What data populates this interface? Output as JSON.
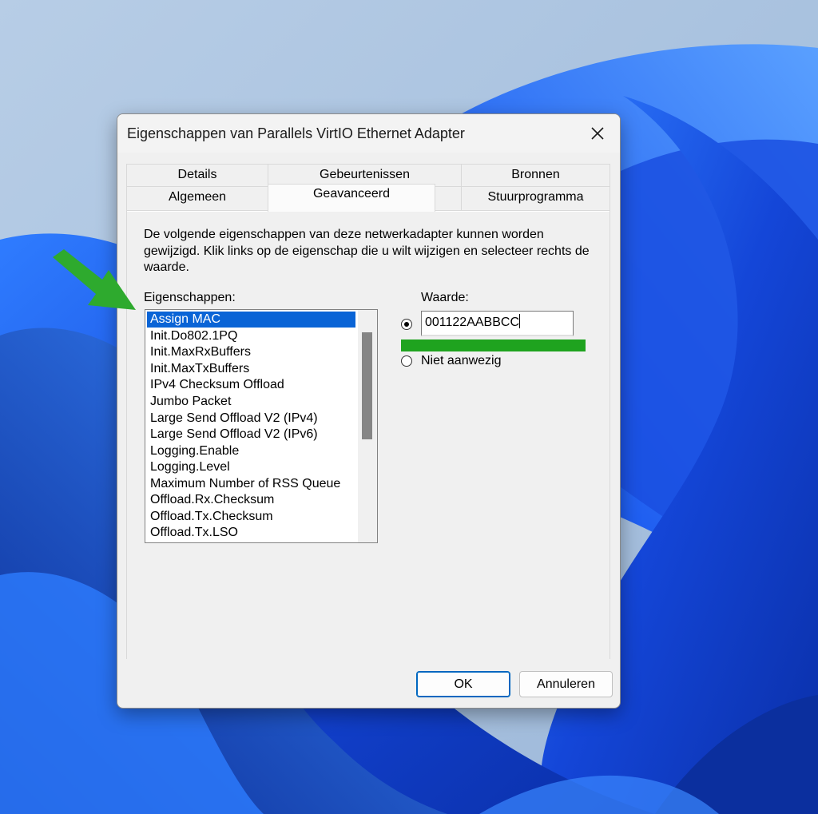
{
  "dialog": {
    "title": "Eigenschappen van Parallels VirtIO Ethernet Adapter"
  },
  "tabs": {
    "row_back": [
      "Details",
      "Gebeurtenissen",
      "Bronnen"
    ],
    "row_front": [
      "Algemeen",
      "Geavanceerd",
      "Stuurprogramma"
    ],
    "active": "Geavanceerd"
  },
  "advanced": {
    "description": "De volgende eigenschappen van deze netwerkadapter kunnen worden gewijzigd. Klik links op de eigenschap die u wilt wijzigen en selecteer rechts de waarde.",
    "properties_label": "Eigenschappen:",
    "properties": [
      "Assign MAC",
      "Init.Do802.1PQ",
      "Init.MaxRxBuffers",
      "Init.MaxTxBuffers",
      "IPv4 Checksum Offload",
      "Jumbo Packet",
      "Large Send Offload V2 (IPv4)",
      "Large Send Offload V2 (IPv6)",
      "Logging.Enable",
      "Logging.Level",
      "Maximum Number of RSS Queue",
      "Offload.Rx.Checksum",
      "Offload.Tx.Checksum",
      "Offload.Tx.LSO"
    ],
    "selected_property": "Assign MAC",
    "value_label": "Waarde:",
    "value": "001122AABBCC",
    "not_present_label": "Niet aanwezig",
    "selected_option": "value"
  },
  "buttons": {
    "ok": "OK",
    "cancel": "Annuleren"
  },
  "annotations": {
    "arrow_color": "#2eaa2e",
    "underline_color": "#1fa31f"
  },
  "colors": {
    "selection": "#0a64d6",
    "dialog_bg": "#f0f0f0",
    "wallpaper_blue": "#1f56e6"
  }
}
